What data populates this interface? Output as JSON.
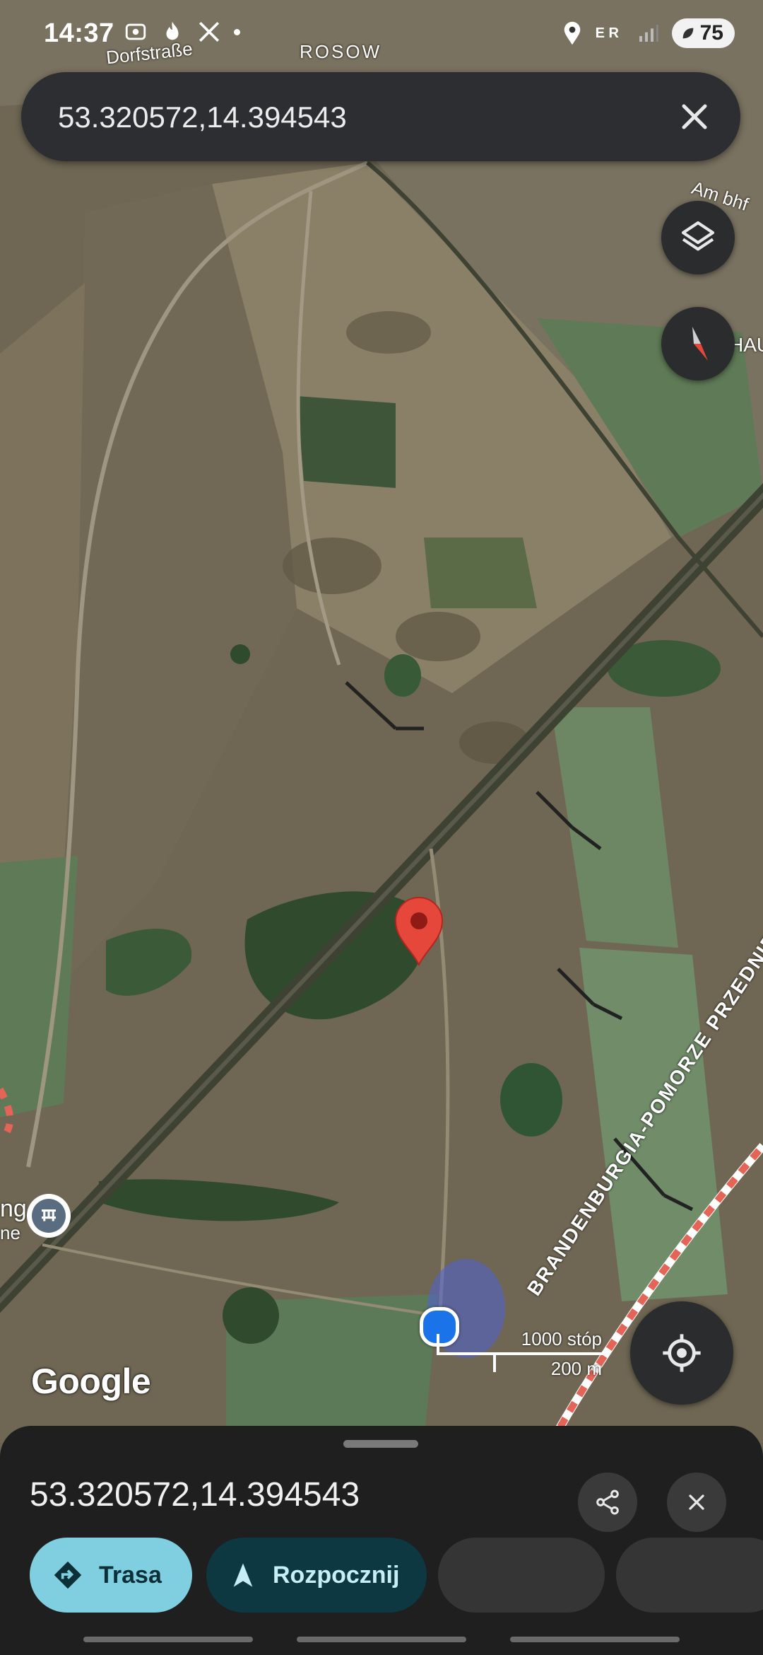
{
  "status_bar": {
    "time": "14:37",
    "network_letters": "E R",
    "battery": "75"
  },
  "search": {
    "query": "53.320572,14.394543"
  },
  "map": {
    "labels": {
      "dorfstrasse": "Dorfstraße",
      "rosow": "ROSOW",
      "am_bhf": "Am bhf",
      "hau": "HAU",
      "left_place_1": "ng",
      "left_place_2": "ne",
      "road_label": "BRANDENBURGIA-POMORZE PRZEDNIE"
    },
    "scale": {
      "feet": "1000 stóp",
      "meters": "200 m"
    },
    "attribution": "Google",
    "pin_color": "#e5473b",
    "location_dot_color": "#1a73e8"
  },
  "sheet": {
    "coordinates": "53.320572,14.394543",
    "buttons": {
      "trasa": "Trasa",
      "start": "Rozpocznij"
    }
  },
  "icons": [
    "status-location-icon",
    "layers-icon",
    "compass-icon",
    "close-icon",
    "share-icon",
    "my-location-icon",
    "directions-icon",
    "navigation-arrow-icon"
  ]
}
